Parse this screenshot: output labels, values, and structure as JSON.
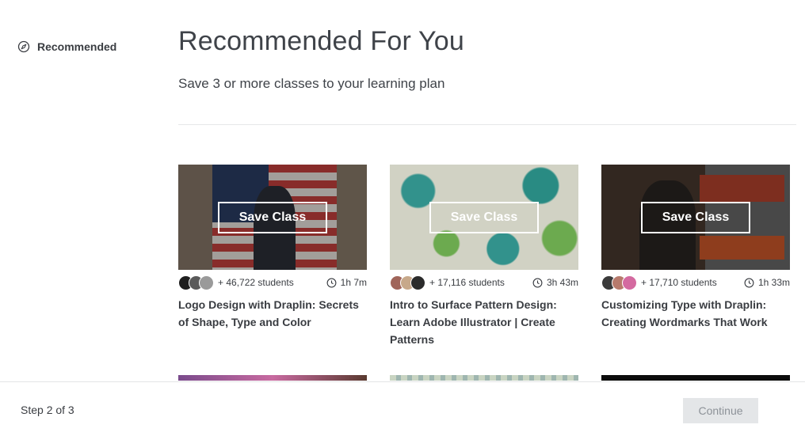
{
  "sidebar": {
    "items": [
      {
        "label": "Recommended",
        "icon": "compass-icon"
      }
    ]
  },
  "main": {
    "title": "Recommended For You",
    "subtitle": "Save 3 or more classes to your learning plan"
  },
  "cards": [
    {
      "save_label": "Save Class",
      "students": "+ 46,722 students",
      "duration": "1h 7m",
      "title": "Logo Design with Draplin: Secrets of Shape, Type and Color"
    },
    {
      "save_label": "Save Class",
      "students": "+ 17,116 students",
      "duration": "3h 43m",
      "title": "Intro to Surface Pattern Design: Learn Adobe Illustrator | Create Patterns"
    },
    {
      "save_label": "Save Class",
      "students": "+ 17,710 students",
      "duration": "1h 33m",
      "title": "Customizing Type with Draplin: Creating Wordmarks That Work"
    }
  ],
  "footer": {
    "step": "Step 2 of 3",
    "continue_label": "Continue"
  },
  "colors": {
    "text": "#3a3d42",
    "divider": "#e6e7e9",
    "button_disabled_bg": "#e4e6e8",
    "button_disabled_text": "#8d9298"
  }
}
